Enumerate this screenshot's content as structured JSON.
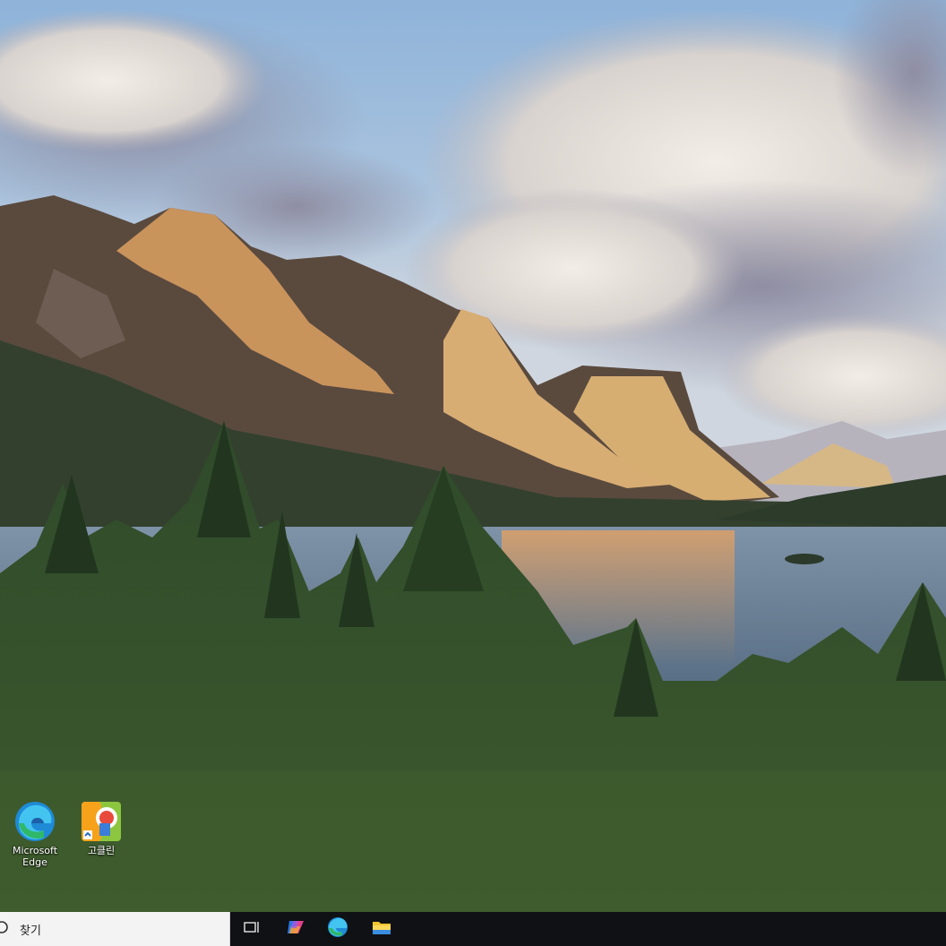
{
  "desktop": {
    "icons": [
      {
        "label": "Microsoft\nEdge",
        "icon": "edge-icon"
      },
      {
        "label": "고클린",
        "icon": "goclean-icon"
      }
    ]
  },
  "taskbar": {
    "search": {
      "placeholder": "찾기",
      "icon": "search-icon"
    },
    "buttons": [
      {
        "icon": "task-view-icon"
      },
      {
        "icon": "copilot-icon"
      },
      {
        "icon": "edge-icon"
      },
      {
        "icon": "file-explorer-icon"
      }
    ]
  },
  "colors": {
    "taskbar": "#0f1114",
    "search_bg": "#f3f3f3"
  }
}
